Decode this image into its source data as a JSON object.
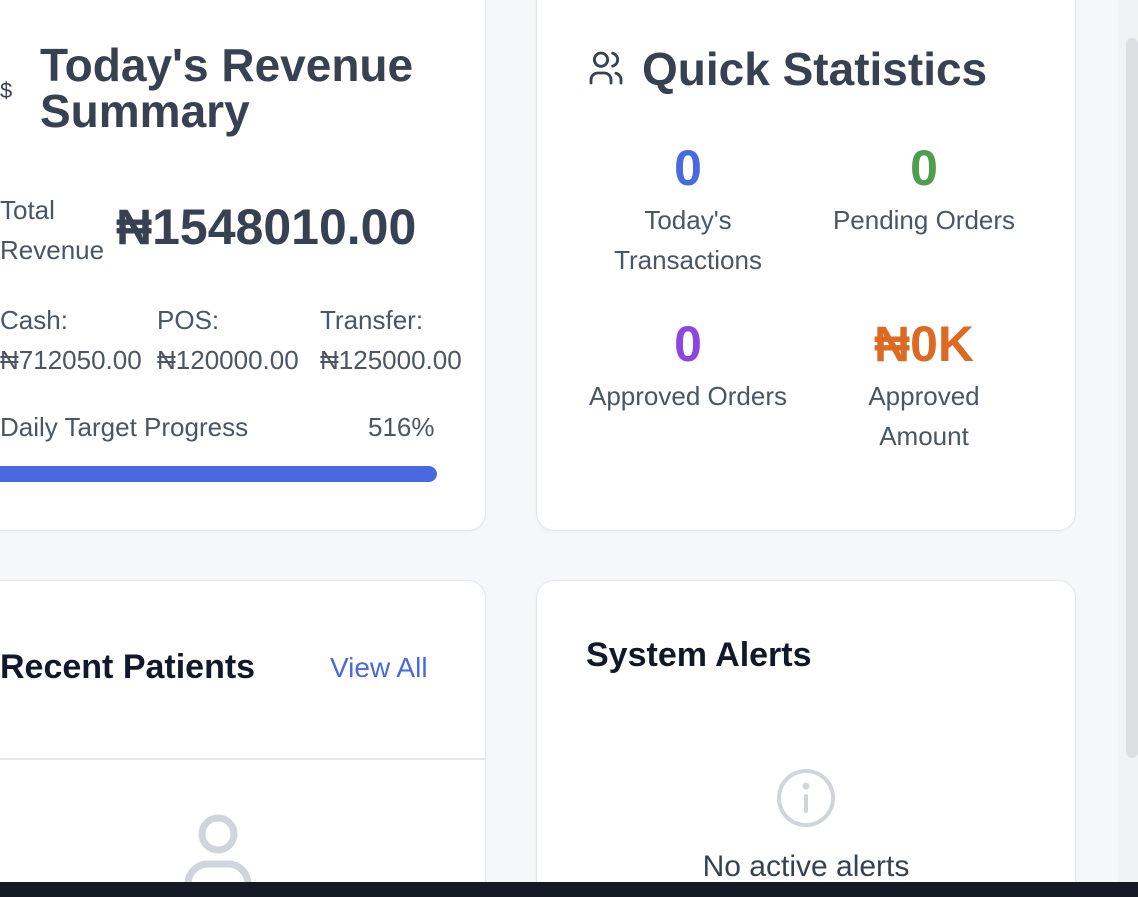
{
  "revenue": {
    "currency_icon": "dollar-icon",
    "currency_glyph": "$",
    "title": "Today's Revenue Summary",
    "total_label": "Total Revenue",
    "total_value": "₦1548010.00",
    "cash_label": "Cash:",
    "cash_value": "₦712050.00",
    "pos_label": "POS:",
    "pos_value": "₦120000.00",
    "transfer_label": "Transfer:",
    "transfer_value": "₦125000.00",
    "target_label": "Daily Target Progress",
    "target_percent_text": "516%",
    "target_progress_fraction": 1.0
  },
  "stats": {
    "icon": "users-icon",
    "title": "Quick Statistics",
    "items": [
      {
        "value": "0",
        "label": "Today's Transactions",
        "color": "#4a68e0"
      },
      {
        "value": "0",
        "label": "Pending Orders",
        "color": "#4f9d4f"
      },
      {
        "value": "0",
        "label": "Approved Orders",
        "color": "#8b45e0"
      },
      {
        "value": "₦0K",
        "label": "Approved Amount",
        "color": "#dd6a22"
      }
    ]
  },
  "patients": {
    "title": "Recent Patients",
    "view_all": "View All",
    "empty_icon": "person-icon"
  },
  "alerts": {
    "title": "System Alerts",
    "empty_icon": "info-icon",
    "empty_text": "No active alerts"
  },
  "colors": {
    "accent": "#4a68e0",
    "progress": "#4a68e0",
    "taskbar": "#151a26"
  }
}
